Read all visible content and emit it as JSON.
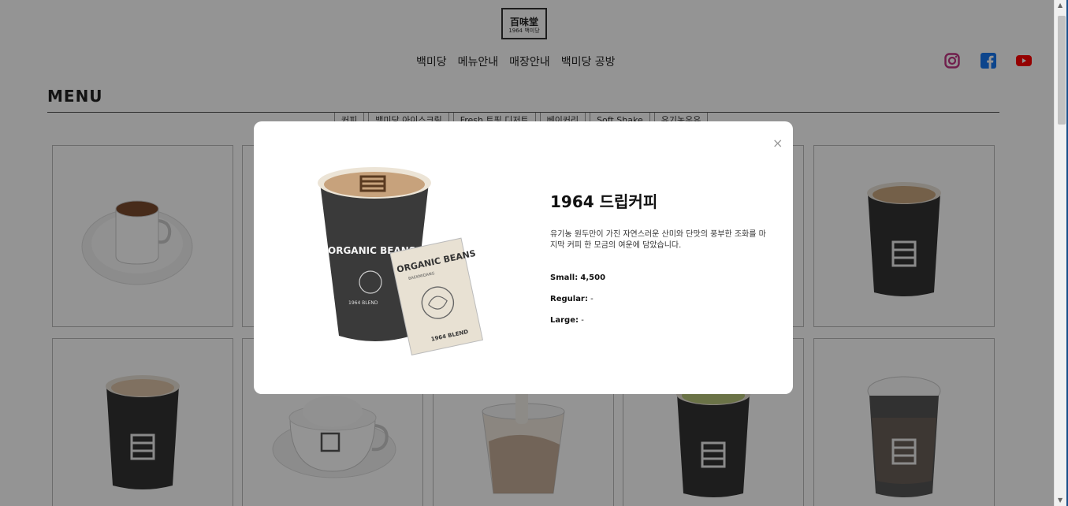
{
  "header": {
    "logo": {
      "main": "百味堂",
      "sub": "1964 백미당"
    },
    "nav": [
      "백미당",
      "메뉴안내",
      "매장안내",
      "백미당 공방"
    ],
    "social_icons": [
      "instagram-icon",
      "facebook-icon",
      "youtube-icon"
    ]
  },
  "menu": {
    "title": "MENU",
    "categories": [
      "커피",
      "백미당 아이스크림",
      "Fresh 트핑 디저트",
      "베이커리",
      "Soft Shake",
      "유기농우유"
    ]
  },
  "modal": {
    "close_label": "×",
    "product_title": "1964 드립커피",
    "description": "유기농 원두만이 가진 자연스러운 산미와 단맛의 풍부한 조화를 마지막 커피 한 모금의 여운에 담았습니다.",
    "prices": [
      {
        "label": "Small:",
        "value": "4,500"
      },
      {
        "label": "Regular:",
        "value": "-"
      },
      {
        "label": "Large:",
        "value": "-"
      }
    ],
    "image_text": {
      "cup": "ORGANIC BEANS",
      "cup_sub": "1964 BLEND",
      "bag": "ORGANIC BEANS",
      "bag_brand": "BAEKMIDANG",
      "bag_sub": "1964 BLEND"
    }
  },
  "product_images": [
    "espresso-cup-image",
    "latte-cup-image",
    "coffee-cup-image",
    "latte-cup-image",
    "cappuccino-cup-image",
    "cream-coffee-image",
    "affogato-cup-image",
    "matcha-latte-image",
    "sleeve-cup-image"
  ],
  "colors": {
    "overlay": "#000000",
    "instagram": "#c13584",
    "facebook": "#1877f2",
    "youtube": "#ff0000"
  }
}
